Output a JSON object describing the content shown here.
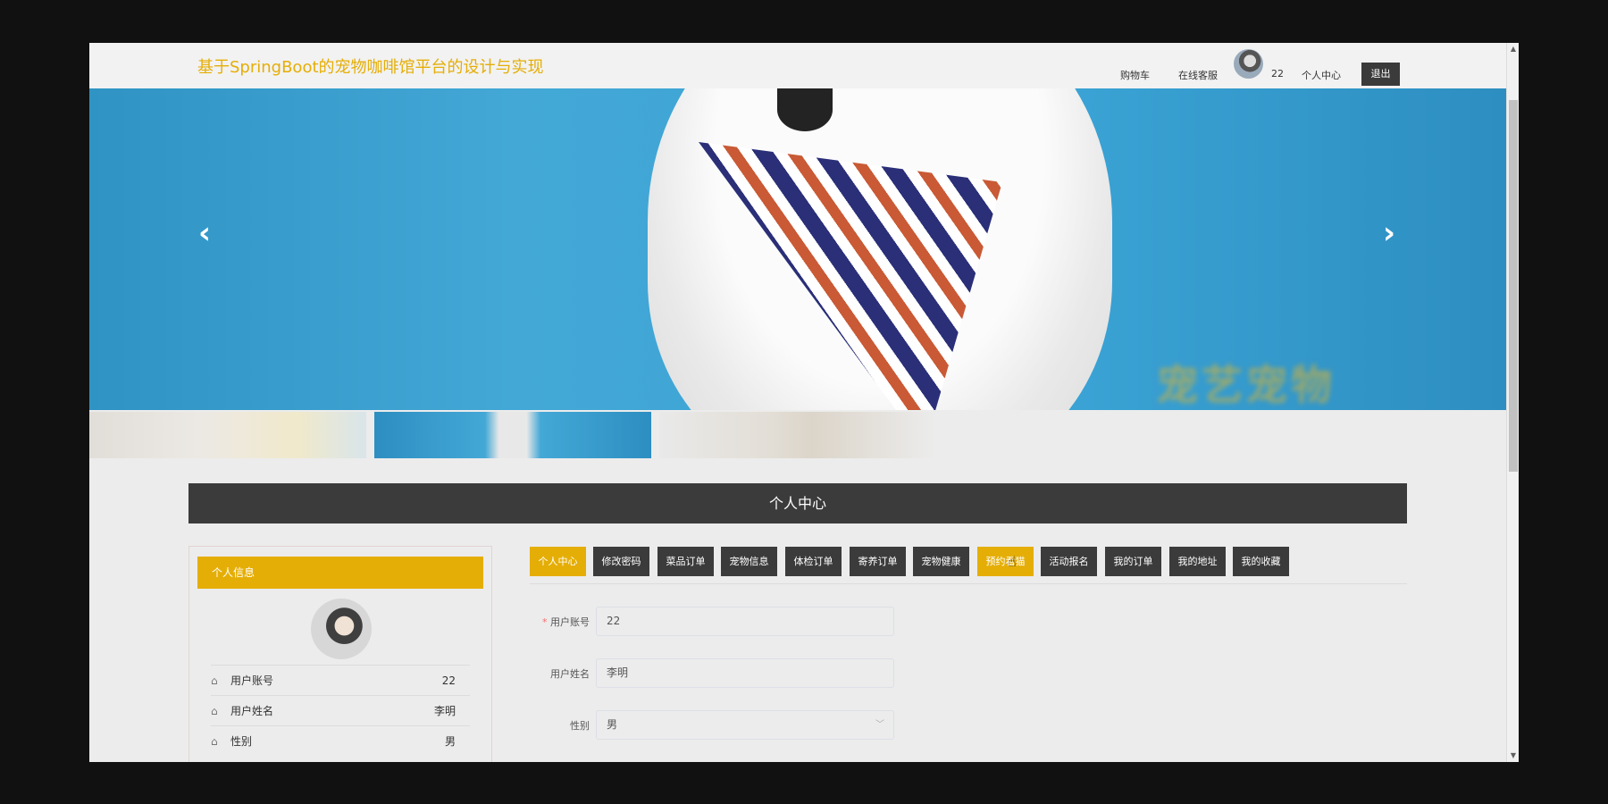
{
  "header": {
    "site_title": "基于SpringBoot的宠物咖啡馆平台的设计与实现",
    "nav": {
      "cart": "购物车",
      "service": "在线客服",
      "username": "22",
      "center": "个人中心",
      "logout": "退出"
    }
  },
  "banner": {
    "watermark": "宠艺宠物",
    "prev_icon": "‹",
    "next_icon": "›"
  },
  "section": {
    "title": "个人中心"
  },
  "sidebar": {
    "heading": "个人信息",
    "rows": [
      {
        "label": "用户账号",
        "value": "22"
      },
      {
        "label": "用户姓名",
        "value": "李明"
      },
      {
        "label": "性别",
        "value": "男"
      }
    ]
  },
  "tabs": [
    {
      "label": "个人中心",
      "active": true
    },
    {
      "label": "修改密码"
    },
    {
      "label": "菜品订单"
    },
    {
      "label": "宠物信息"
    },
    {
      "label": "体检订单"
    },
    {
      "label": "寄养订单"
    },
    {
      "label": "宠物健康"
    },
    {
      "label": "预约看猫",
      "highlighted": true
    },
    {
      "label": "活动报名"
    },
    {
      "label": "我的订单"
    },
    {
      "label": "我的地址"
    },
    {
      "label": "我的收藏"
    }
  ],
  "form": {
    "account": {
      "label": "用户账号",
      "value": "22",
      "required": "*"
    },
    "name": {
      "label": "用户姓名",
      "value": "李明"
    },
    "gender": {
      "label": "性别",
      "value": "男"
    }
  },
  "colors": {
    "accent": "#e5ae06",
    "dark": "#3b3b3b",
    "background": "#ececec"
  }
}
